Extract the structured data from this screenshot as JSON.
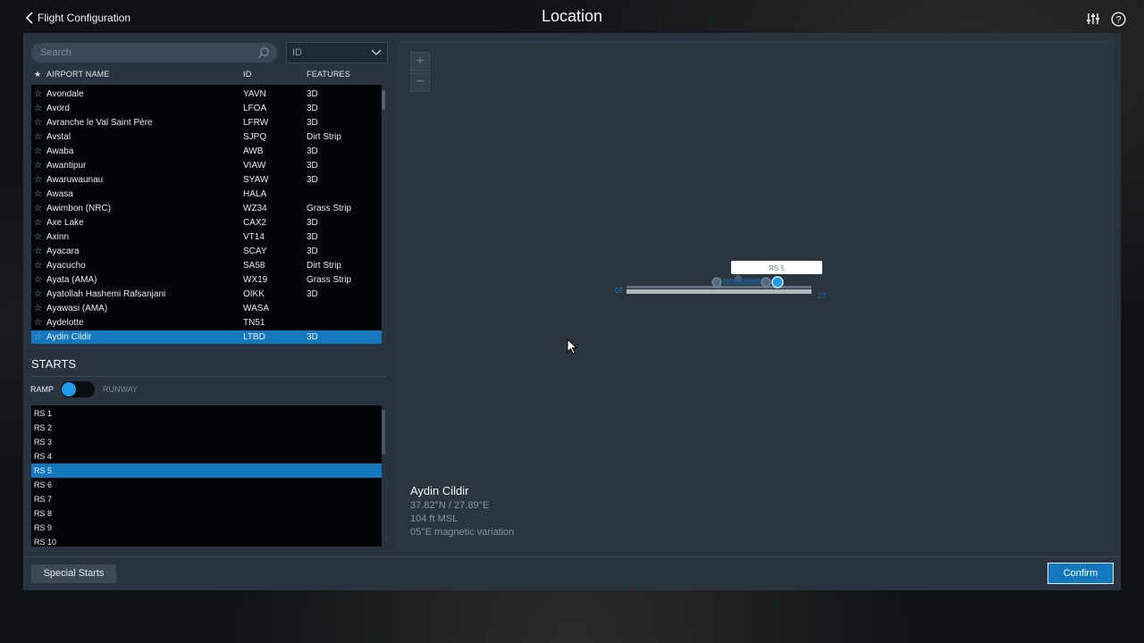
{
  "header": {
    "back_label": "Flight Configuration",
    "title": "Location",
    "icons": [
      "sliders-icon",
      "help-icon"
    ]
  },
  "airport_search": {
    "placeholder": "Search",
    "filter_select": "ID"
  },
  "airport_table": {
    "headers": {
      "name": "AIRPORT NAME",
      "id": "ID",
      "features": "FEATURES"
    },
    "rows": [
      {
        "name": "Avondale",
        "id": "YAVN",
        "features": "3D"
      },
      {
        "name": "Avord",
        "id": "LFOA",
        "features": "3D"
      },
      {
        "name": "Avranche le Val Saint Père",
        "id": "LFRW",
        "features": "3D"
      },
      {
        "name": "Avstal",
        "id": "SJPQ",
        "features": "Dirt Strip"
      },
      {
        "name": "Awaba",
        "id": "AWB",
        "features": "3D"
      },
      {
        "name": "Awantipur",
        "id": "VIAW",
        "features": "3D"
      },
      {
        "name": "Awaruwaunau",
        "id": "SYAW",
        "features": "3D"
      },
      {
        "name": "Awasa",
        "id": "HALA",
        "features": ""
      },
      {
        "name": "Awimbon (NRC)",
        "id": "WZ34",
        "features": "Grass Strip"
      },
      {
        "name": "Axe Lake",
        "id": "CAX2",
        "features": "3D"
      },
      {
        "name": "Axinn",
        "id": "VT14",
        "features": "3D"
      },
      {
        "name": "Ayacara",
        "id": "SCAY",
        "features": "3D"
      },
      {
        "name": "Ayacucho",
        "id": "SA58",
        "features": "Dirt Strip"
      },
      {
        "name": "Ayata (AMA)",
        "id": "WX19",
        "features": "Grass Strip"
      },
      {
        "name": "Ayatollah Hashemi Rafsanjani",
        "id": "OIKK",
        "features": "3D"
      },
      {
        "name": "Ayawasi (AMA)",
        "id": "WASA",
        "features": ""
      },
      {
        "name": "Aydelotte",
        "id": "TN51",
        "features": ""
      },
      {
        "name": "Aydin Cildir",
        "id": "LTBD",
        "features": "3D"
      }
    ],
    "selected_index": 17
  },
  "starts": {
    "title": "STARTS",
    "toggle_left": "RAMP",
    "toggle_right": "RUNWAY",
    "items": [
      "RS 1",
      "RS 2",
      "RS 3",
      "RS 4",
      "RS 5",
      "RS 6",
      "RS 7",
      "RS 8",
      "RS 9",
      "RS 10"
    ],
    "selected_index": 4
  },
  "map": {
    "popup_label": "RS 5",
    "runway_end_left": "09",
    "runway_end_right": "27",
    "airport_name": "Aydin Cildir",
    "coordinates": "37.82°N / 27.89°E",
    "elevation": "104 ft MSL",
    "magnetic_variation": "05°E magnetic variation"
  },
  "footer": {
    "special_starts_label": "Special Starts",
    "confirm_label": "Confirm"
  },
  "colors": {
    "selection": "#1478be",
    "panel": "#293440",
    "list_bg": "#030608",
    "toggle_knob": "#1f9be8"
  }
}
